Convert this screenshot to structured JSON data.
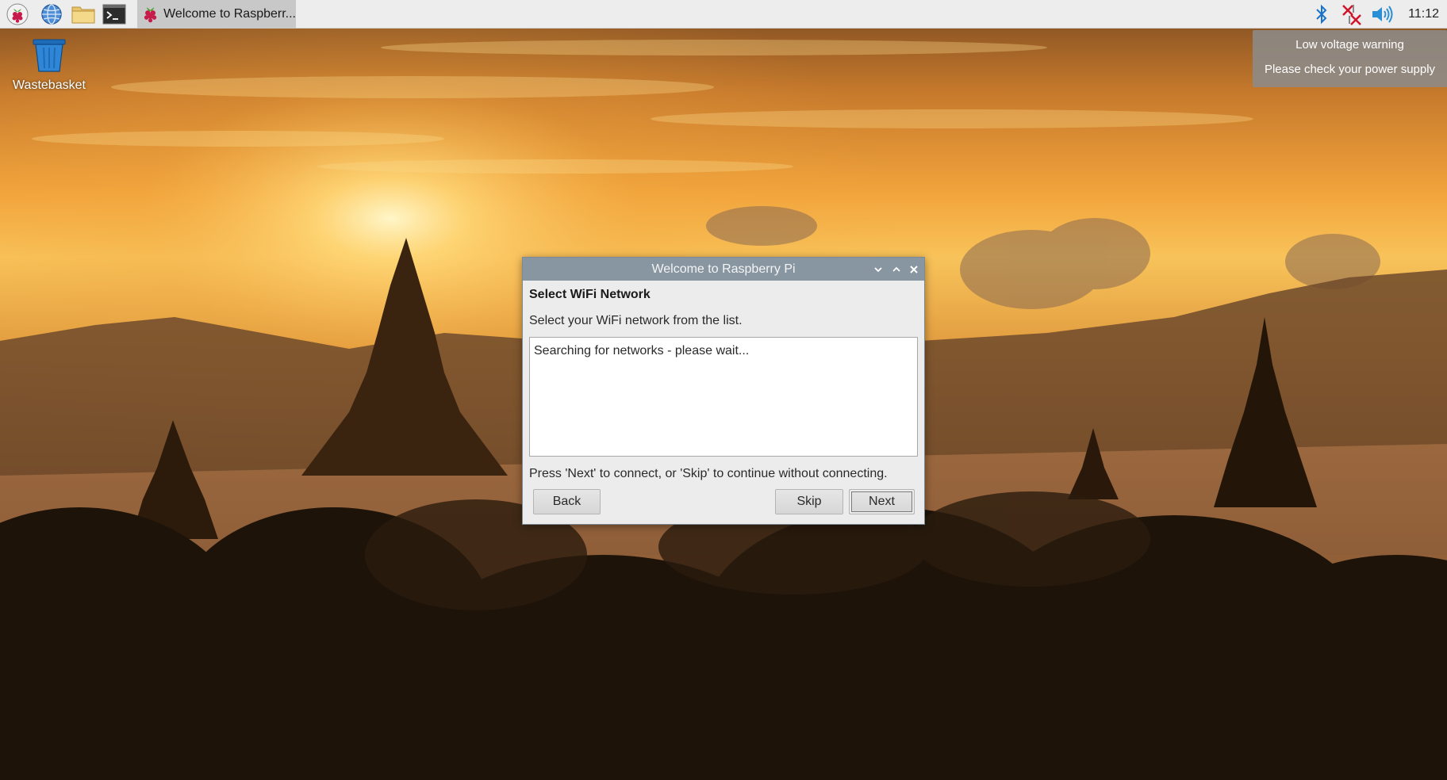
{
  "taskbar": {
    "launchers": [
      "raspberry-menu",
      "web-browser",
      "file-manager",
      "terminal"
    ],
    "task": {
      "label": "Welcome to Raspberr..."
    },
    "clock": "11:12"
  },
  "desktop": {
    "icons": [
      {
        "label": "Wastebasket"
      }
    ]
  },
  "notification": {
    "line1": "Low voltage warning",
    "line2": "Please check your power supply"
  },
  "dialog": {
    "title": "Welcome to Raspberry Pi",
    "heading": "Select WiFi Network",
    "instruction": "Select your WiFi network from the list.",
    "list_status": "Searching for networks - please wait...",
    "footer": "Press 'Next' to connect, or 'Skip' to continue without connecting.",
    "buttons": {
      "back": "Back",
      "skip": "Skip",
      "next": "Next"
    }
  },
  "colors": {
    "titlebar": "#8896a2",
    "dialog_bg": "#ececec",
    "taskbar_bg": "#ededed",
    "bluetooth": "#1a73c8",
    "network_error": "#d0142a",
    "volume": "#2b8fd6"
  }
}
